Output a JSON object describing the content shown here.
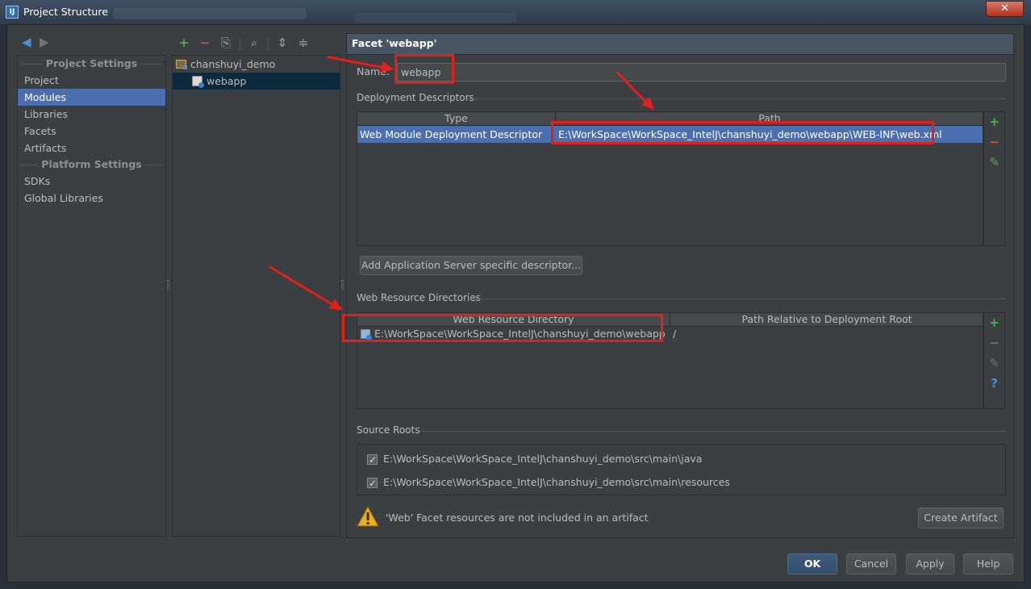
{
  "window": {
    "title": "Project Structure",
    "close_label": "✕"
  },
  "left": {
    "project_settings_header": "Project Settings",
    "project_items": [
      "Project",
      "Modules",
      "Libraries",
      "Facets",
      "Artifacts"
    ],
    "selected": "Modules",
    "platform_settings_header": "Platform Settings",
    "platform_items": [
      "SDKs",
      "Global Libraries"
    ]
  },
  "toolbar": {
    "add": "+",
    "remove": "−",
    "copy": "⎘",
    "search": "🔍",
    "expand": "⇕",
    "collapse": "≑"
  },
  "tree": {
    "module": "chanshuyi_demo",
    "facet": "webapp"
  },
  "facet": {
    "header": "Facet 'webapp'",
    "name_label": "Name:",
    "name_value": "webapp",
    "deployment_descriptors": {
      "title": "Deployment Descriptors",
      "columns": [
        "Type",
        "Path"
      ],
      "rows": [
        {
          "type": "Web Module Deployment Descriptor",
          "path": "E:\\WorkSpace\\WorkSpace_IntelJ\\chanshuyi_demo\\webapp\\WEB-INF\\web.xml"
        }
      ]
    },
    "add_server_descriptor_button": "Add Application Server specific descriptor...",
    "web_resource_directories": {
      "title": "Web Resource Directories",
      "columns": [
        "Web Resource Directory",
        "Path Relative to Deployment Root"
      ],
      "rows": [
        {
          "directory": "E:\\WorkSpace\\WorkSpace_IntelJ\\chanshuyi_demo\\webapp",
          "relative_path": "/"
        }
      ]
    },
    "source_roots": {
      "title": "Source Roots",
      "items": [
        {
          "path": "E:\\WorkSpace\\WorkSpace_IntelJ\\chanshuyi_demo\\src\\main\\java",
          "checked": true
        },
        {
          "path": "E:\\WorkSpace\\WorkSpace_IntelJ\\chanshuyi_demo\\src\\main\\resources",
          "checked": true
        }
      ]
    },
    "warning": "'Web' Facet resources are not included in an artifact",
    "create_artifact_button": "Create Artifact"
  },
  "side_tools": {
    "add": "+",
    "remove": "−",
    "edit": "✎",
    "help": "?"
  },
  "footer": {
    "ok": "OK",
    "cancel": "Cancel",
    "apply": "Apply",
    "help": "Help"
  },
  "colors": {
    "background": "#3c3f41",
    "selection": "#4b6eaf",
    "annotation": "#e0201b",
    "add": "#4fae4f",
    "remove": "#c75450"
  }
}
